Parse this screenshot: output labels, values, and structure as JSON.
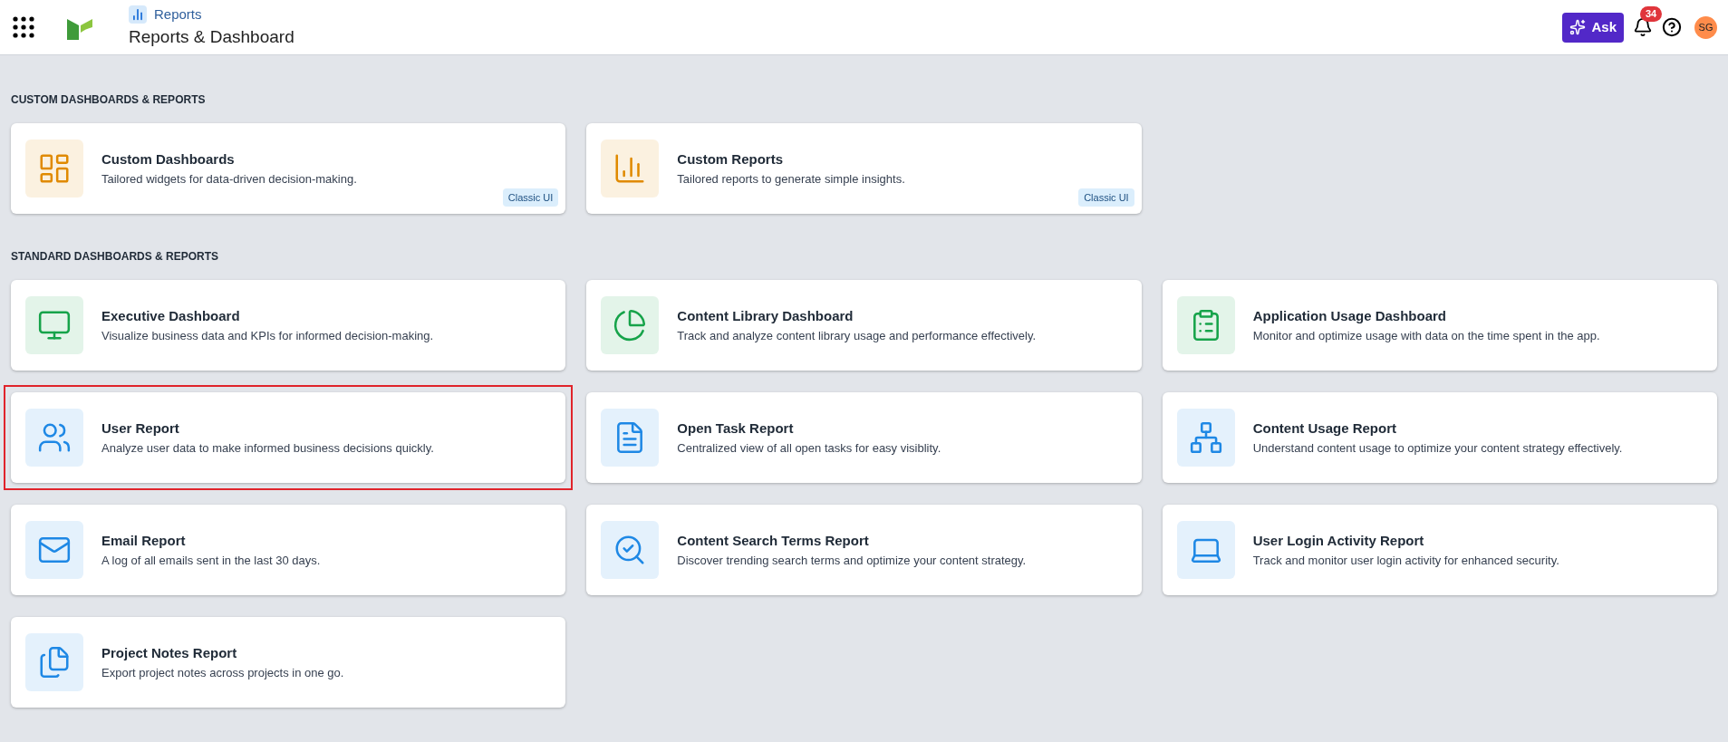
{
  "header": {
    "breadcrumb": "Reports",
    "title": "Reports & Dashboard",
    "ask_button": "Ask",
    "notifications": {
      "count": "34"
    },
    "avatar": "SG"
  },
  "sections": [
    {
      "title": "CUSTOM DASHBOARDS & REPORTS",
      "cards": [
        {
          "title": "Custom Dashboards",
          "description": "Tailored widgets for data-driven decision-making.",
          "badge": "Classic UI",
          "color": "#e08a00",
          "selected": false
        },
        {
          "title": "Custom Reports",
          "description": "Tailored reports to generate simple insights.",
          "badge": "Classic UI",
          "color": "#e08a00",
          "selected": false
        }
      ]
    },
    {
      "title": "STANDARD DASHBOARDS & REPORTS",
      "cards": [
        {
          "title": "Executive Dashboard",
          "description": "Visualize business data and KPIs for informed decision-making.",
          "color": "#16a34a",
          "selected": false
        },
        {
          "title": "Content Library Dashboard",
          "description": "Track and analyze content library usage and performance effectively.",
          "color": "#16a34a",
          "selected": false
        },
        {
          "title": "Application Usage Dashboard",
          "description": "Monitor and optimize usage with data on the time spent in the app.",
          "color": "#16a34a",
          "selected": false
        },
        {
          "title": "User Report",
          "description": "Analyze user data to make informed business decisions quickly.",
          "color": "#1e88e5",
          "selected": true
        },
        {
          "title": "Open Task Report",
          "description": "Centralized view of all open tasks for easy visiblity.",
          "color": "#1e88e5",
          "selected": false
        },
        {
          "title": "Content Usage Report",
          "description": "Understand content usage to optimize your content strategy effectively.",
          "color": "#1e88e5",
          "selected": false
        },
        {
          "title": "Email Report",
          "description": "A log of all emails sent in the last 30 days.",
          "color": "#1e88e5",
          "selected": false
        },
        {
          "title": "Content Search Terms Report",
          "description": "Discover trending search terms and optimize your content strategy.",
          "color": "#1e88e5",
          "selected": false
        },
        {
          "title": "User Login Activity Report",
          "description": "Track and monitor user login activity for enhanced security.",
          "color": "#1e88e5",
          "selected": false
        },
        {
          "title": "Project Notes Report",
          "description": "Export project notes across projects in one go.",
          "color": "#1e88e5",
          "selected": false
        }
      ]
    }
  ]
}
